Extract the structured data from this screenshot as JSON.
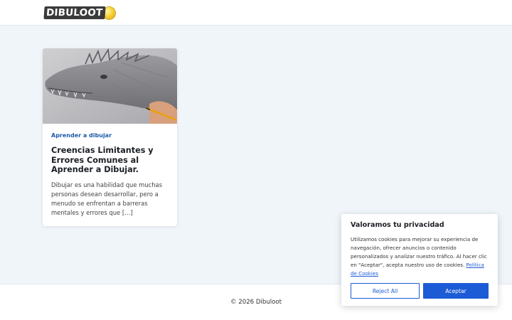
{
  "header": {
    "logo_text": "DIBULOOT"
  },
  "article": {
    "image_alt": "Dibujo a lápiz de la cabeza de un dragón",
    "category": "Aprender a dibujar",
    "title": "Creencias Limitantes y Errores Comunes al Aprender a Dibujar.",
    "excerpt": "Dibujar es una habilidad que muchas personas desean desarrollar, pero a menudo se enfrentan a barreras mentales y errores que […]"
  },
  "footer": {
    "copyright": "© 2026 Dibuloot"
  },
  "cookie_banner": {
    "title": "Valoramos tu privacidad",
    "text": "Utilizamos cookies para mejorar su experiencia de navegación, ofrecer anuncios o contenido personalizados y analizar nuestro tráfico. Al hacer clic en \"Aceptar\", acepta nuestro uso de cookies.",
    "policy_link": "Política de Cookies",
    "reject_label": "Reject All",
    "accept_label": "Aceptar"
  },
  "colors": {
    "page_background": "#f0f5fa",
    "accent": "#1c5bd6",
    "category": "#1e5aa8"
  }
}
